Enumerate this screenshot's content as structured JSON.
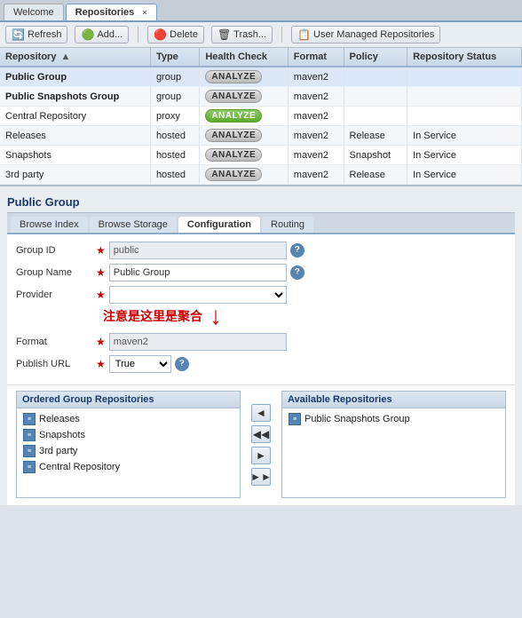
{
  "tabs": {
    "items": [
      {
        "label": "Welcome",
        "active": false
      },
      {
        "label": "Repositories",
        "active": true
      }
    ],
    "close_symbol": "×"
  },
  "toolbar": {
    "refresh_label": "Refresh",
    "add_label": "Add...",
    "delete_label": "Delete",
    "trash_label": "Trash...",
    "user_managed_label": "User Managed Repositories"
  },
  "table": {
    "columns": [
      "Repository",
      "Type",
      "Health Check",
      "Format",
      "Policy",
      "Repository Status"
    ],
    "sort_arrow": "▲",
    "rows": [
      {
        "name": "Public Group",
        "bold": true,
        "type": "group",
        "analyze": "ANALYZE",
        "analyze_style": "gray",
        "format": "maven2",
        "policy": "",
        "status": ""
      },
      {
        "name": "Public Snapshots Group",
        "bold": true,
        "type": "group",
        "analyze": "ANALYZE",
        "analyze_style": "gray",
        "format": "maven2",
        "policy": "",
        "status": ""
      },
      {
        "name": "Central Repository",
        "bold": false,
        "type": "proxy",
        "analyze": "ANALYZE",
        "analyze_style": "green",
        "format": "maven2",
        "policy": "",
        "status": ""
      },
      {
        "name": "Releases",
        "bold": false,
        "type": "hosted",
        "analyze": "ANALYZE",
        "analyze_style": "gray",
        "format": "maven2",
        "policy": "Release",
        "status": "In Service"
      },
      {
        "name": "Snapshots",
        "bold": false,
        "type": "hosted",
        "analyze": "ANALYZE",
        "analyze_style": "gray",
        "format": "maven2",
        "policy": "Snapshot",
        "status": "In Service"
      },
      {
        "name": "3rd party",
        "bold": false,
        "type": "hosted",
        "analyze": "ANALYZE",
        "analyze_style": "gray",
        "format": "maven2",
        "policy": "Release",
        "status": "In Service"
      }
    ]
  },
  "detail": {
    "title": "Public Group",
    "sub_tabs": [
      {
        "label": "Browse Index",
        "active": false
      },
      {
        "label": "Browse Storage",
        "active": false
      },
      {
        "label": "Configuration",
        "active": true
      },
      {
        "label": "Routing",
        "active": false
      }
    ],
    "form": {
      "group_id_label": "Group ID",
      "group_id_placeholder": "public",
      "group_name_label": "Group Name",
      "group_name_value": "Public Group",
      "provider_label": "Provider",
      "annotation_text": "注意是这里是聚合",
      "format_label": "Format",
      "format_value": "maven2",
      "publish_url_label": "Publish URL",
      "publish_url_value": "True"
    },
    "ordered_repos": {
      "title": "Ordered Group Repositories",
      "items": [
        "Releases",
        "Snapshots",
        "3rd party",
        "Central Repository"
      ]
    },
    "available_repos": {
      "title": "Available Repositories",
      "items": [
        "Public Snapshots Group"
      ]
    },
    "arrow_buttons": [
      "◄",
      "◀◀",
      "►",
      "►►"
    ]
  }
}
